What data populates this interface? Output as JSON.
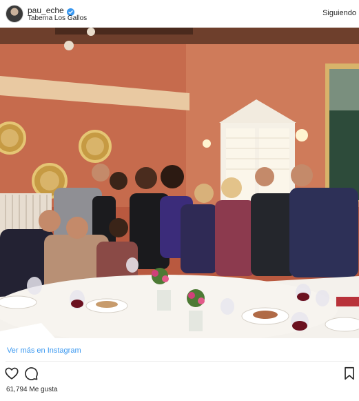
{
  "post": {
    "username": "pau_eche",
    "verified_icon": "verified-badge-icon",
    "location": "Taberna Los Gallos",
    "follow_label": "Siguiendo",
    "photo_icon": "group-photo",
    "view_more_label": "Ver más en Instagram",
    "likes_label": "61,794 Me gusta"
  },
  "actions": {
    "like_icon": "heart-icon",
    "comment_icon": "comment-icon",
    "save_icon": "bookmark-icon"
  },
  "colors": {
    "link": "#3897f0",
    "verified": "#3897f0",
    "text": "#262626",
    "wall": "#c96d4f"
  }
}
